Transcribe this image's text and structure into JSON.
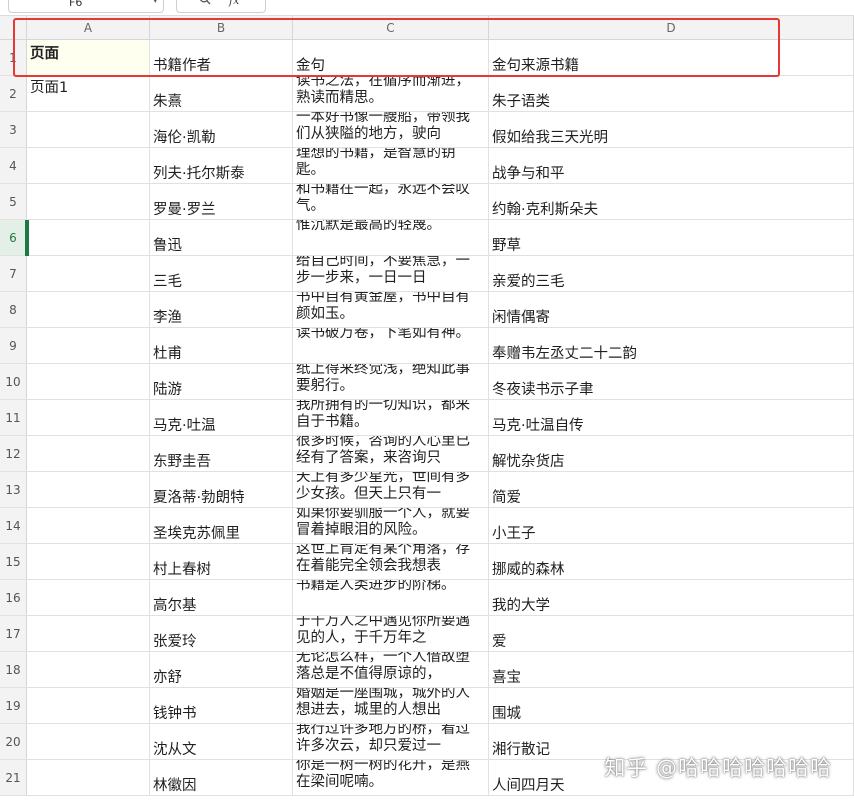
{
  "toolbar": {
    "name_box": "F6",
    "fx_label": "fx"
  },
  "columns": [
    "A",
    "B",
    "C",
    "D"
  ],
  "header_row": {
    "a": "页面",
    "b": "书籍作者",
    "c": "金句",
    "d": "金句来源书籍"
  },
  "rows": [
    {
      "num": "2",
      "a": "页面1",
      "b": "朱熹",
      "c": "读书之法，在循序而渐进，熟读而精思。",
      "d": "朱子语类"
    },
    {
      "num": "3",
      "a": "",
      "b": "海伦·凯勒",
      "c": "一本好书像一艘船，带领我们从狭隘的地方，驶向",
      "d": "假如给我三天光明"
    },
    {
      "num": "4",
      "a": "",
      "b": "列夫·托尔斯泰",
      "c": "理想的书籍，是智慧的钥匙。",
      "d": "战争与和平"
    },
    {
      "num": "5",
      "a": "",
      "b": "罗曼·罗兰",
      "c": "和书籍在一起，永远不会叹气。",
      "d": "约翰·克利斯朵夫"
    },
    {
      "num": "6",
      "a": "",
      "b": "鲁迅",
      "c": "惟沉默是最高的轻蔑。",
      "d": "野草"
    },
    {
      "num": "7",
      "a": "",
      "b": "三毛",
      "c": "给自己时间，不要焦急，一步一步来，一日一日",
      "d": "亲爱的三毛"
    },
    {
      "num": "8",
      "a": "",
      "b": "李渔",
      "c": "书中自有黄金屋，书中自有颜如玉。",
      "d": "闲情偶寄"
    },
    {
      "num": "9",
      "a": "",
      "b": "杜甫",
      "c": "读书破万卷，下笔如有神。",
      "d": "奉赠韦左丞丈二十二韵"
    },
    {
      "num": "10",
      "a": "",
      "b": "陆游",
      "c": "纸上得来终觉浅，绝知此事要躬行。",
      "d": "冬夜读书示子聿"
    },
    {
      "num": "11",
      "a": "",
      "b": "马克·吐温",
      "c": "我所拥有的一切知识，都来自于书籍。",
      "d": "马克·吐温自传"
    },
    {
      "num": "12",
      "a": "",
      "b": "东野圭吾",
      "c": "很多时候，咨询的人心里已经有了答案，来咨询只",
      "d": "解忧杂货店"
    },
    {
      "num": "13",
      "a": "",
      "b": "夏洛蒂·勃朗特",
      "c": "天上有多少星光，世间有多少女孩。但天上只有一",
      "d": "简爱"
    },
    {
      "num": "14",
      "a": "",
      "b": "圣埃克苏佩里",
      "c": "如果你要驯服一个人，就要冒着掉眼泪的风险。",
      "d": "小王子"
    },
    {
      "num": "15",
      "a": "",
      "b": "村上春树",
      "c": "这世上肯定有某个角落，存在着能完全领会我想表",
      "d": "挪威的森林"
    },
    {
      "num": "16",
      "a": "",
      "b": "高尔基",
      "c": "书籍是人类进步的阶梯。",
      "d": "我的大学"
    },
    {
      "num": "17",
      "a": "",
      "b": "张爱玲",
      "c": "于千万人之中遇见你所要遇见的人，于千万年之",
      "d": "爱"
    },
    {
      "num": "18",
      "a": "",
      "b": "亦舒",
      "c": "无论怎么样，一个人借故堕落总是不值得原谅的，",
      "d": "喜宝"
    },
    {
      "num": "19",
      "a": "",
      "b": "钱钟书",
      "c": "婚姻是一座围城，城外的人想进去，城里的人想出",
      "d": "围城"
    },
    {
      "num": "20",
      "a": "",
      "b": "沈从文",
      "c": "我行过许多地方的桥，看过许多次云，却只爱过一",
      "d": "湘行散记"
    },
    {
      "num": "21",
      "a": "",
      "b": "林徽因",
      "c": "你是一树一树的花开，是燕在梁间呢喃。",
      "d": "人间四月天"
    }
  ],
  "watermark": "知乎 @哈哈哈哈哈哈哈",
  "colors": {
    "selection": "#1e7a45",
    "highlight_box": "#e53935",
    "header_bg": "#f3f3f3",
    "a1_bg": "#fffff0"
  }
}
